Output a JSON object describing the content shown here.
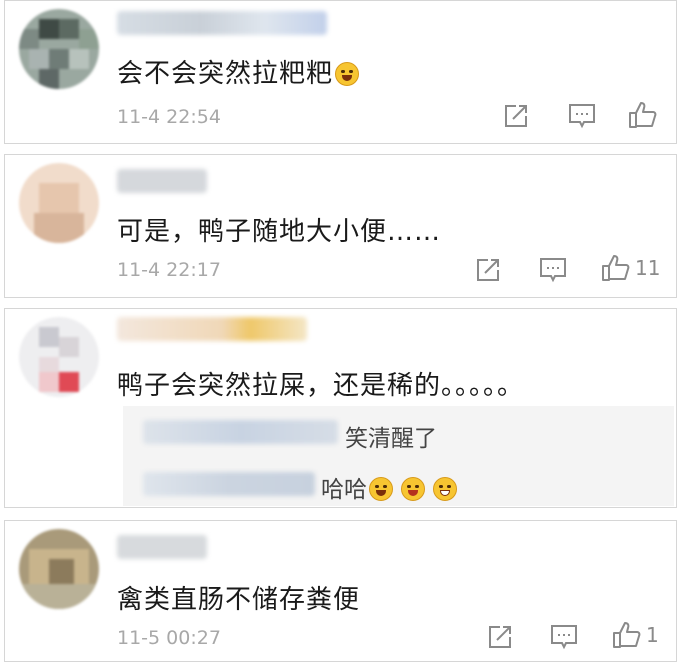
{
  "colors": {
    "card_border": "#d6d6d6",
    "text": "#1a1a1a",
    "time": "#a8a8a8",
    "icon": "#8a8a8a",
    "reply_bg": "#f4f4f4"
  },
  "comments": [
    {
      "text": "会不会突然拉粑粑",
      "emoji": "laugh-cry-emoji",
      "time": "11-4 22:54",
      "likes": ""
    },
    {
      "text": "可是，鸭子随地大小便……",
      "time": "11-4 22:17",
      "likes": "11"
    },
    {
      "text": "鸭子会突然拉屎，还是稀的。。。。。",
      "replies": [
        {
          "text": "笑清醒了"
        },
        {
          "text": "哈哈",
          "emojis": [
            "laugh-cry-emoji",
            "grin-emoji",
            "laugh-emoji"
          ]
        }
      ]
    },
    {
      "text": "禽类直肠不储存粪便",
      "time": "11-5 00:27",
      "likes": "1"
    }
  ],
  "icons": {
    "share": "share-icon",
    "reply": "comment-icon",
    "like": "thumbs-up-icon"
  }
}
